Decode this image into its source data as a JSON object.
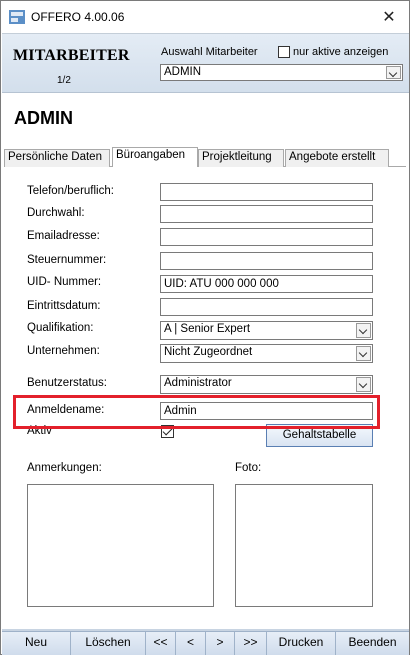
{
  "window": {
    "title": "OFFERO 4.00.06",
    "close_glyph": "✕"
  },
  "header": {
    "module_title": "MITARBEITER",
    "record_position": "1/2",
    "select_label": "Auswahl Mitarbeiter",
    "only_active_label": "nur aktive anzeigen",
    "selected_employee": "ADMIN"
  },
  "record_name": "ADMIN",
  "tabs": [
    {
      "label": "Persönliche Daten"
    },
    {
      "label": "Büroangaben"
    },
    {
      "label": "Projektleitung"
    },
    {
      "label": "Angebote erstellt"
    }
  ],
  "active_tab": "Büroangaben",
  "fields": {
    "telefon_label": "Telefon/beruflich:",
    "telefon_value": "",
    "durchwahl_label": "Durchwahl:",
    "durchwahl_value": "",
    "email_label": "Emailadresse:",
    "email_value": "",
    "steuer_label": "Steuernummer:",
    "steuer_value": "",
    "uid_label": "UID- Nummer:",
    "uid_value": "UID: ATU 000 000 000",
    "eintritt_label": "Eintrittsdatum:",
    "eintritt_value": "",
    "qualifikation_label": "Qualifikation:",
    "qualifikation_value": "A | Senior Expert",
    "unternehmen_label": "Unternehmen:",
    "unternehmen_value": "Nicht Zugeordnet",
    "benutzerstatus_label": "Benutzerstatus:",
    "benutzerstatus_value": "Administrator",
    "anmeldename_label": "Anmeldename:",
    "anmeldename_value": "Admin",
    "aktiv_label": "Aktiv",
    "aktiv_checked": true,
    "gehalt_button": "Gehaltstabelle",
    "anmerkungen_label": "Anmerkungen:",
    "foto_label": "Foto:"
  },
  "nav": {
    "neu": "Neu",
    "loeschen": "Löschen",
    "first": "<<",
    "prev": "<",
    "next": ">",
    "last": ">>",
    "drucken": "Drucken",
    "beenden": "Beenden"
  },
  "colors": {
    "highlight": "#e3202b",
    "header_bg": "#dbe5f0",
    "button_border": "#5a7fb3"
  }
}
